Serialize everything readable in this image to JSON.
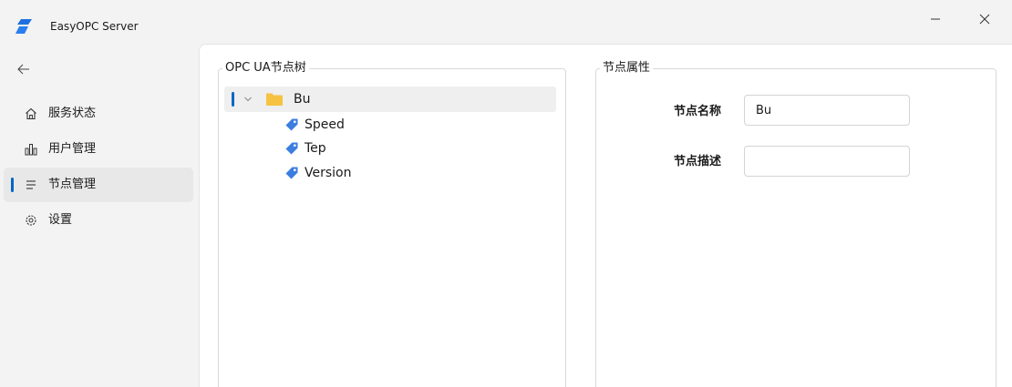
{
  "window": {
    "title": "EasyOPC Server",
    "minimize_icon": "minimize-icon",
    "close_icon": "close-icon"
  },
  "sidebar": {
    "back_icon": "back-arrow-icon",
    "items": [
      {
        "label": "服务状态",
        "icon": "home-icon",
        "active": false
      },
      {
        "label": "用户管理",
        "icon": "people-icon",
        "active": false
      },
      {
        "label": "节点管理",
        "icon": "list-icon",
        "active": true
      },
      {
        "label": "设置",
        "icon": "gear-icon",
        "active": false
      }
    ]
  },
  "tree_panel": {
    "title": "OPC UA节点树",
    "root": {
      "label": "Bu",
      "expanded": true,
      "selected": true
    },
    "children": [
      {
        "label": "Speed"
      },
      {
        "label": "Tep"
      },
      {
        "label": "Version"
      }
    ]
  },
  "properties_panel": {
    "title": "节点属性",
    "name_label": "节点名称",
    "name_value": "Bu",
    "desc_label": "节点描述",
    "desc_value": ""
  },
  "colors": {
    "accent": "#0067c0",
    "folder": "#f5c242",
    "tag": "#3c7de0",
    "selected_bg": "#efefef"
  }
}
